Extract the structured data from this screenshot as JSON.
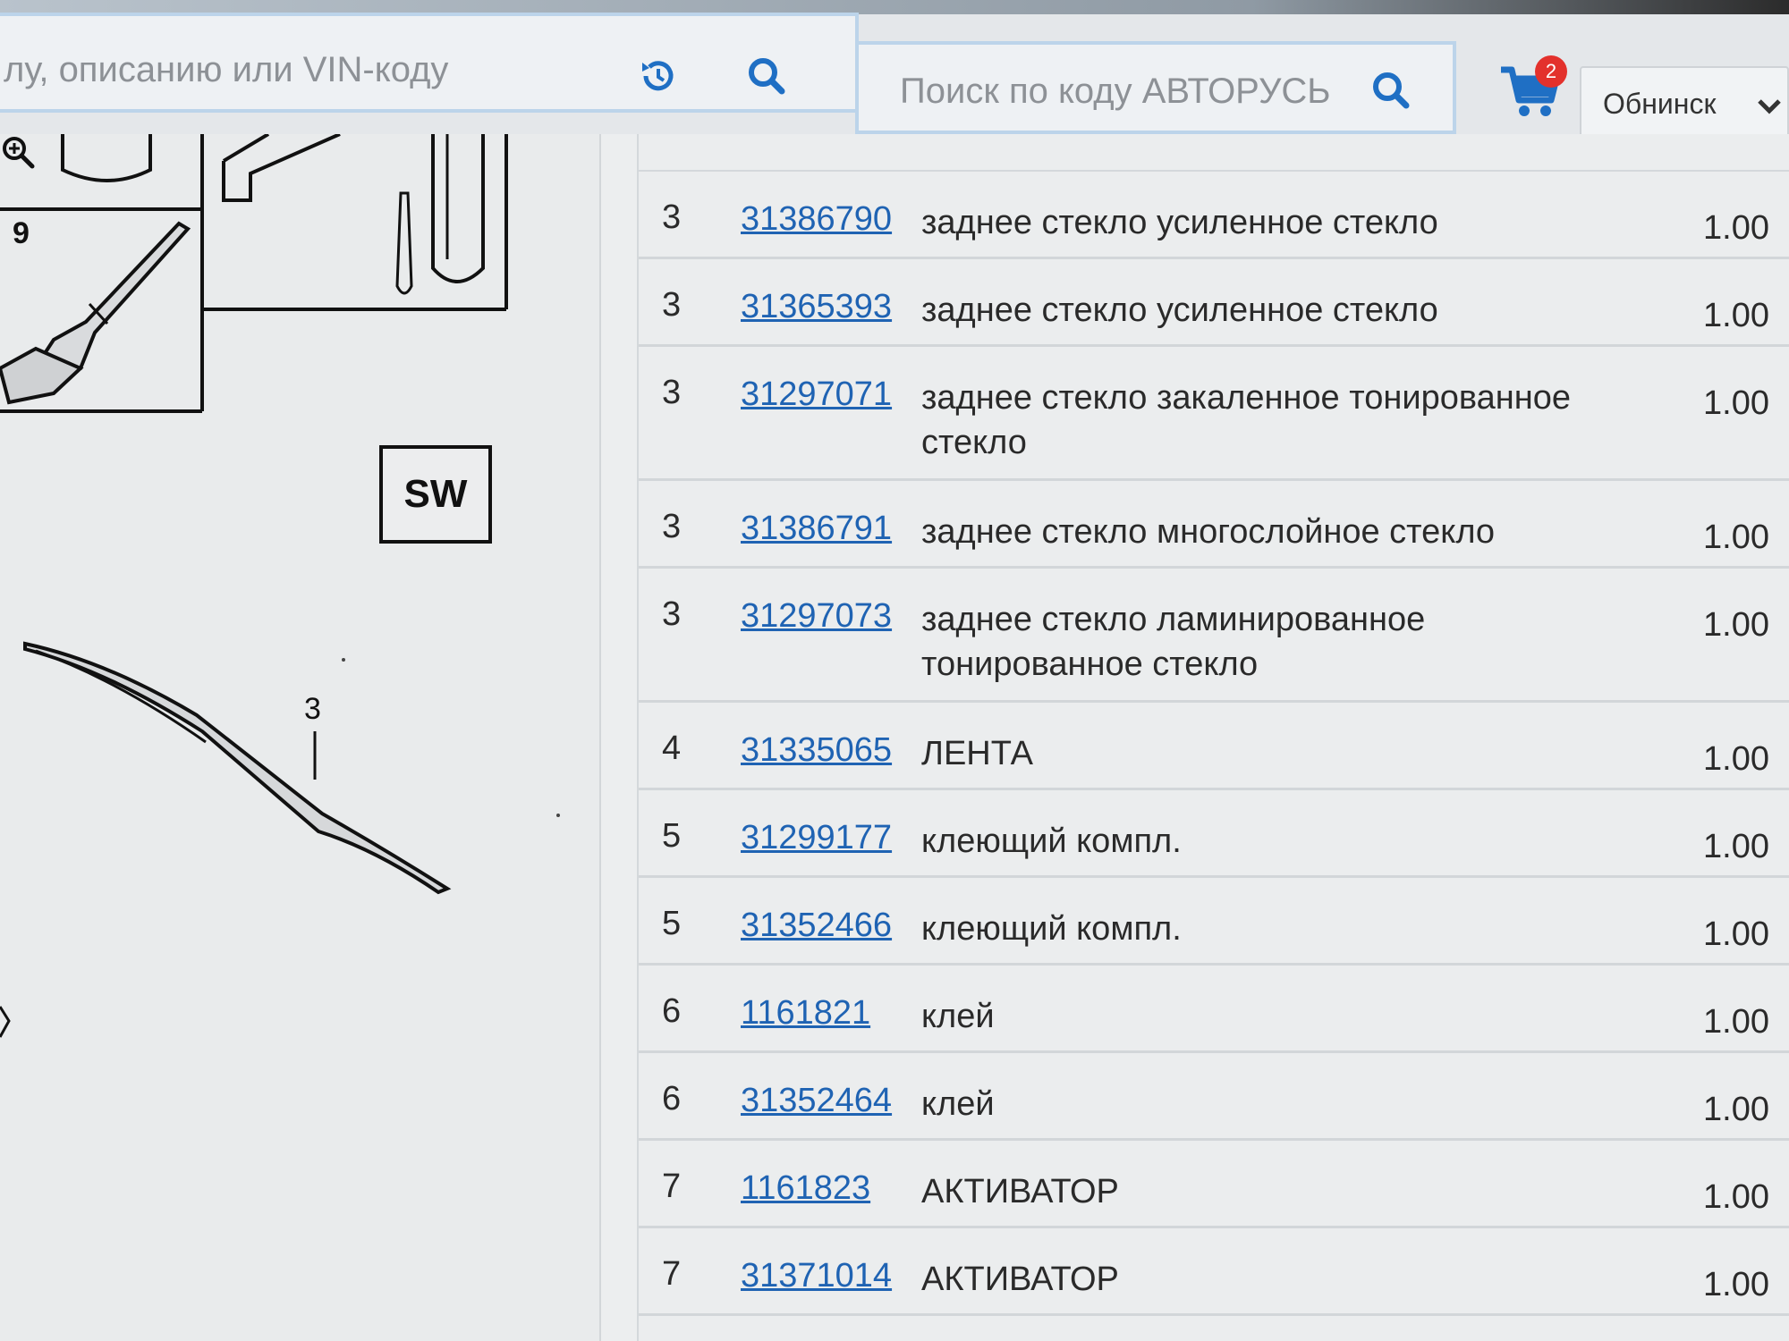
{
  "header": {
    "main_search_placeholder": "лу, описанию или VIN-коду",
    "code_search_placeholder": "Поиск по коду АВТОРУСЬ",
    "cart_count": "2",
    "city": "Обнинск"
  },
  "diagram": {
    "sw_label": "SW",
    "callout_9": "9",
    "callout_3": "3"
  },
  "parts": [
    {
      "num": "3",
      "code": "31386790",
      "desc": "заднее стекло усиленное стекло",
      "qty": "1.00"
    },
    {
      "num": "3",
      "code": "31365393",
      "desc": "заднее стекло усиленное стекло",
      "qty": "1.00"
    },
    {
      "num": "3",
      "code": "31297071",
      "desc": "заднее стекло закаленное тонированное стекло",
      "qty": "1.00"
    },
    {
      "num": "3",
      "code": "31386791",
      "desc": "заднее стекло многослойное стекло",
      "qty": "1.00"
    },
    {
      "num": "3",
      "code": "31297073",
      "desc": "заднее стекло ламинированное тонированное стекло",
      "qty": "1.00"
    },
    {
      "num": "4",
      "code": "31335065",
      "desc": "ЛЕНТА",
      "qty": "1.00"
    },
    {
      "num": "5",
      "code": "31299177",
      "desc": "клеющий компл.",
      "qty": "1.00"
    },
    {
      "num": "5",
      "code": "31352466",
      "desc": "клеющий компл.",
      "qty": "1.00"
    },
    {
      "num": "6",
      "code": "1161821",
      "desc": "клей",
      "qty": "1.00"
    },
    {
      "num": "6",
      "code": "31352464",
      "desc": "клей",
      "qty": "1.00"
    },
    {
      "num": "7",
      "code": "1161823",
      "desc": "АКТИВАТОР",
      "qty": "1.00"
    },
    {
      "num": "7",
      "code": "31371014",
      "desc": "АКТИВАТОР",
      "qty": "1.00"
    }
  ],
  "colors": {
    "link": "#1f63b3",
    "accent": "#1f6fc4",
    "badge": "#e3312c"
  }
}
